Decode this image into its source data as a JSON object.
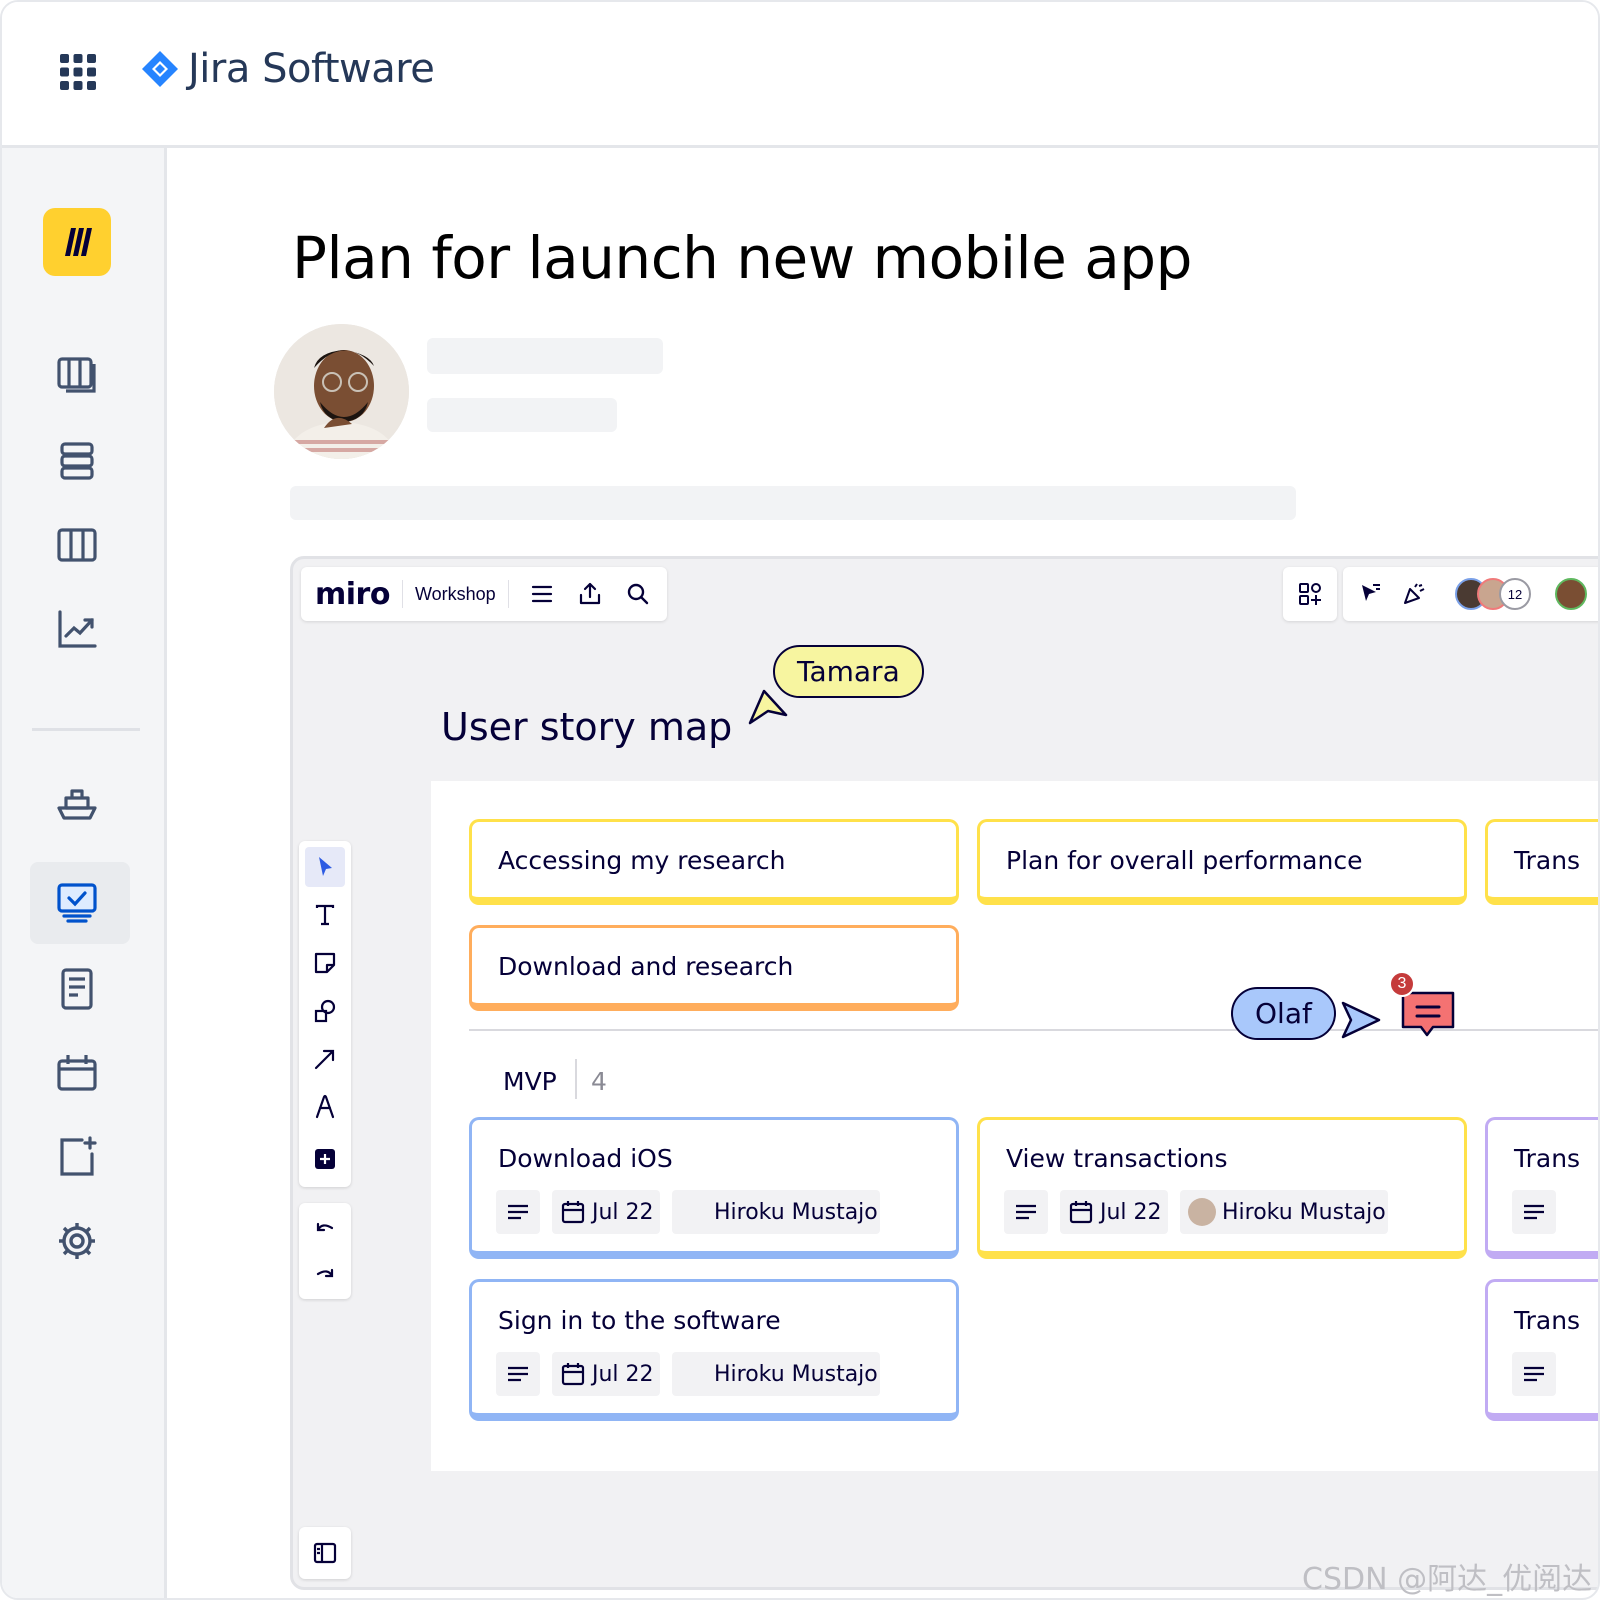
{
  "app": {
    "brand": "Jira Software"
  },
  "page": {
    "title": "Plan for launch new mobile app"
  },
  "sidebar": {
    "items": [
      {
        "name": "board-icon"
      },
      {
        "name": "stack-icon"
      },
      {
        "name": "columns-icon"
      },
      {
        "name": "chart-icon"
      },
      {
        "name": "ship-icon"
      },
      {
        "name": "monitor-check-icon"
      },
      {
        "name": "document-icon"
      },
      {
        "name": "calendar-icon"
      },
      {
        "name": "add-page-icon"
      },
      {
        "name": "gear-icon"
      }
    ]
  },
  "miro": {
    "logo": "miro",
    "board_name": "Workshop",
    "collaborator_count": "12",
    "board_title": "User story map",
    "cursors": {
      "tamara": "Tamara",
      "olaf": "Olaf"
    },
    "comment_badge": "3",
    "cards_top": [
      {
        "title": "Accessing my research",
        "color": "#ffe14a"
      },
      {
        "title": "Plan for overall performance",
        "color": "#ffe14a"
      },
      {
        "title": "Trans",
        "color": "#ffe14a"
      },
      {
        "title": "Download and research",
        "color": "#ffad5c"
      }
    ],
    "section": {
      "label": "MVP",
      "count": "4"
    },
    "cards_mvp": [
      {
        "title": "Download iOS",
        "date": "Jul 22",
        "assignee": "Hiroku Mustajo",
        "color": "#90b5f5"
      },
      {
        "title": "View transactions",
        "date": "Jul 22",
        "assignee": "Hiroku Mustajo",
        "color": "#ffe14a"
      },
      {
        "title": "Trans",
        "color": "#c1abf3"
      },
      {
        "title": "Sign in to the software",
        "date": "Jul 22",
        "assignee": "Hiroku Mustajo",
        "color": "#90b5f5"
      },
      {
        "title": "Trans",
        "color": "#c1abf3"
      }
    ]
  },
  "watermark": "CSDN @阿达_优阅达"
}
